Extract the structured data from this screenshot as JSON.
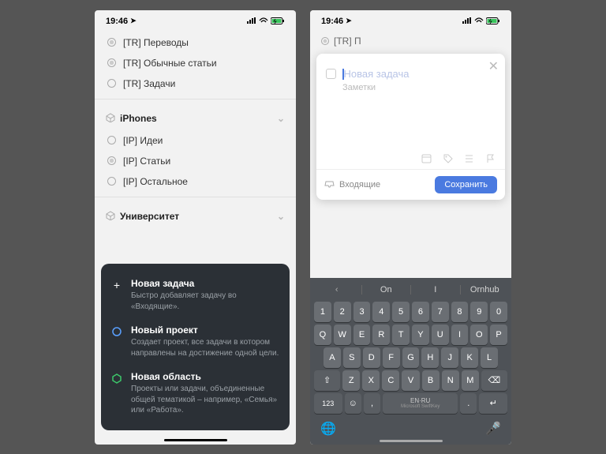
{
  "status": {
    "time": "19:46",
    "location_arrow": "➤"
  },
  "left": {
    "items_top": [
      {
        "label": "[TR] Переводы",
        "icon": "target"
      },
      {
        "label": "[TR] Обычные статьи",
        "icon": "target"
      },
      {
        "label": "[TR] Задачи",
        "icon": "circle"
      }
    ],
    "sections": [
      {
        "name": "iPhones",
        "items": [
          {
            "label": "[IP] Идеи",
            "icon": "circle"
          },
          {
            "label": "[IP] Статьи",
            "icon": "target"
          },
          {
            "label": "[IP] Остальное",
            "icon": "circle"
          }
        ]
      },
      {
        "name": "Университет",
        "items": []
      }
    ],
    "actions": {
      "new_task": {
        "title": "Новая задача",
        "desc": "Быстро добавляет задачу во «Входящие»."
      },
      "new_project": {
        "title": "Новый проект",
        "desc": "Создает проект, все задачи в котором направлены на достижение одной цели."
      },
      "new_area": {
        "title": "Новая область",
        "desc": "Проекты или задачи, объединенные общей тематикой – например, «Семья» или «Работа»."
      }
    }
  },
  "right": {
    "faded_item": "[TR] П",
    "modal": {
      "title_placeholder": "Новая задача",
      "notes_placeholder": "Заметки",
      "inbox": "Входящие",
      "save": "Сохранить"
    },
    "suggestions": [
      "On",
      "I",
      "Ornhub"
    ],
    "keyboard": {
      "row1": [
        "1",
        "2",
        "3",
        "4",
        "5",
        "6",
        "7",
        "8",
        "9",
        "0"
      ],
      "row2": [
        "Q",
        "W",
        "E",
        "R",
        "T",
        "Y",
        "U",
        "I",
        "O",
        "P"
      ],
      "row3": [
        "A",
        "S",
        "D",
        "F",
        "G",
        "H",
        "J",
        "K",
        "L"
      ],
      "row4": [
        "Z",
        "X",
        "C",
        "V",
        "B",
        "N",
        "M"
      ],
      "shift": "⇧",
      "backspace": "⌫",
      "sym": "123",
      "space_top": "EN·RU",
      "space_bottom": "Microsoft SwiftKey",
      "enter": "↵"
    }
  }
}
